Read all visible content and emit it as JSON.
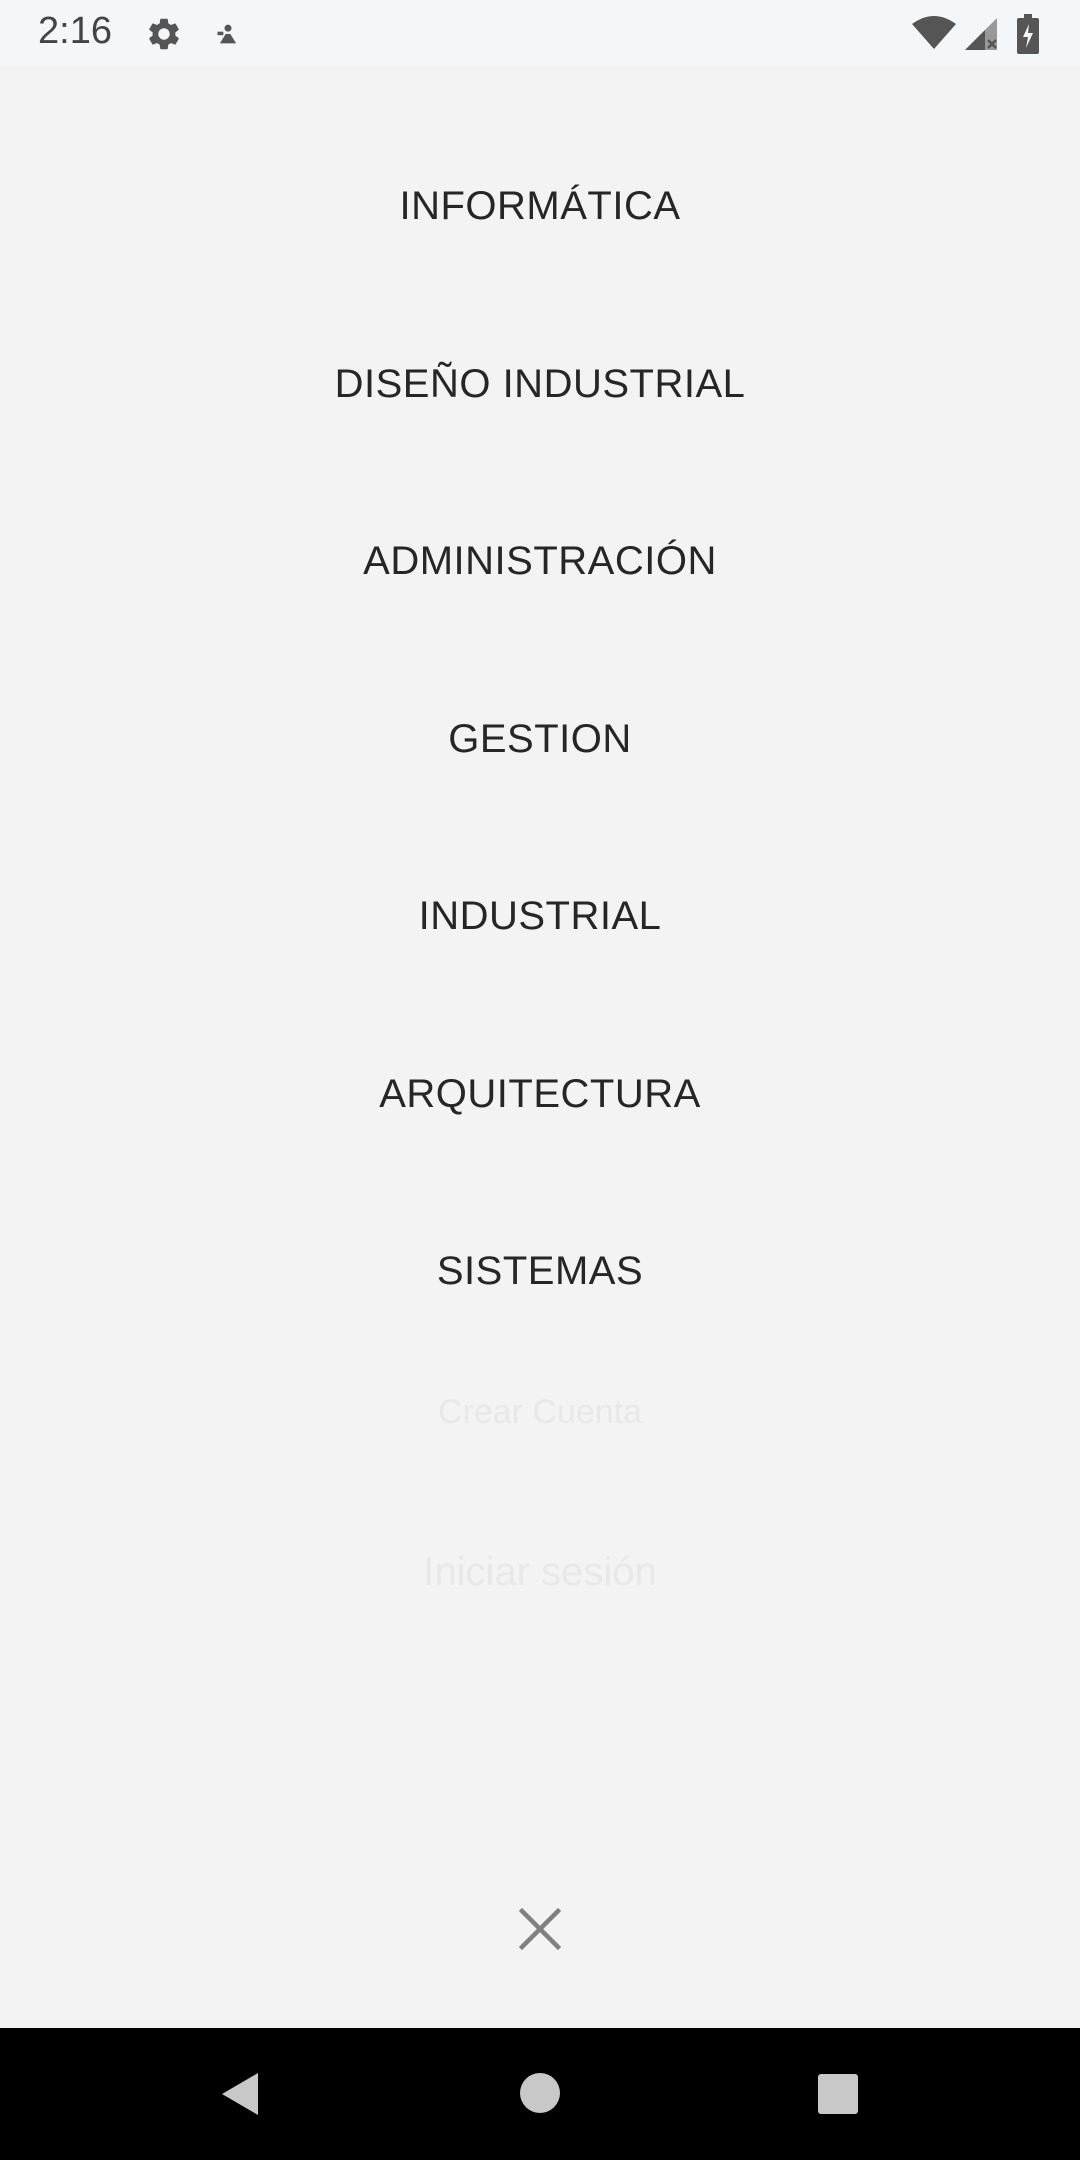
{
  "status_bar": {
    "time": "2:16",
    "icons": [
      "gear-icon",
      "notification-icon",
      "wifi-icon",
      "signal-icon",
      "battery-icon"
    ]
  },
  "menu": {
    "items": [
      {
        "label": "INFORMÁTICA"
      },
      {
        "label": "DISEÑO INDUSTRIAL"
      },
      {
        "label": "ADMINISTRACIÓN"
      },
      {
        "label": "GESTION"
      },
      {
        "label": "INDUSTRIAL"
      },
      {
        "label": "ARQUITECTURA"
      },
      {
        "label": "SISTEMAS"
      }
    ],
    "create_account_label": "Crear Cuenta",
    "login_label": "Iniciar sesión"
  },
  "nav": {
    "icons": [
      "back-icon",
      "home-icon",
      "recents-icon"
    ]
  },
  "colors": {
    "background": "#f3f3f3",
    "text": "#262626",
    "faded_text": "#e8e8e8",
    "close_icon": "#808080",
    "nav_bar": "#000000"
  }
}
